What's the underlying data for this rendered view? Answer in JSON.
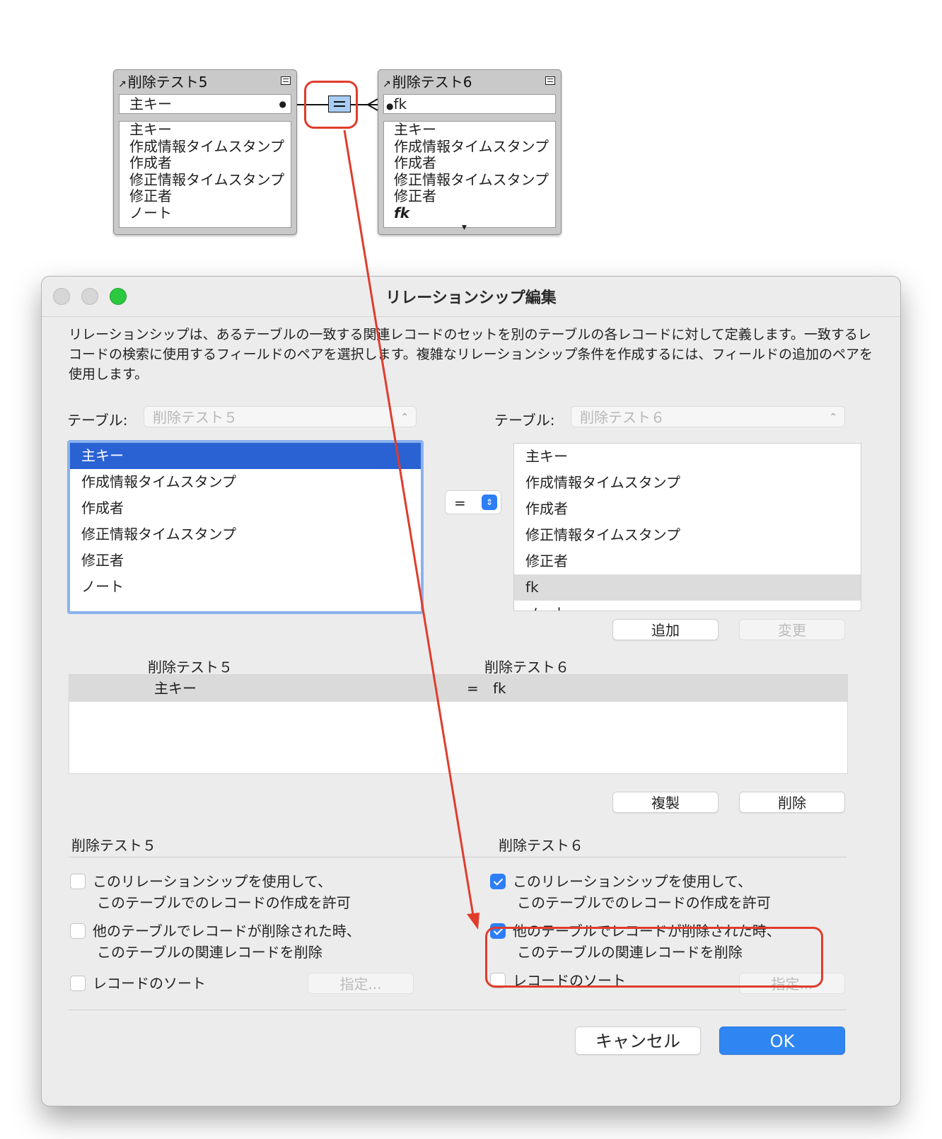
{
  "graph": {
    "left_table": {
      "title": "削除テスト5",
      "key_field": "主キー",
      "fields": [
        "主キー",
        "作成情報タイムスタンプ",
        "作成者",
        "修正情報タイムスタンプ",
        "修正者",
        "ノート"
      ]
    },
    "right_table": {
      "title": "削除テスト6",
      "key_field": "fk",
      "fields": [
        "主キー",
        "作成情報タイムスタンプ",
        "作成者",
        "修正情報タイムスタンプ",
        "修正者",
        "fk"
      ]
    }
  },
  "dialog": {
    "title": "リレーションシップ編集",
    "description": "リレーションシップは、あるテーブルの一致する関連レコードのセットを別のテーブルの各レコードに対して定義します。一致するレコードの検索に使用するフィールドのペアを選択します。複雑なリレーションシップ条件を作成するには、フィールドの追加のペアを使用します。",
    "left": {
      "table_label": "テーブル:",
      "table_value": "削除テスト５",
      "fields": [
        "主キー",
        "作成情報タイムスタンプ",
        "作成者",
        "修正情報タイムスタンプ",
        "修正者",
        "ノート"
      ],
      "selected_field": "主キー"
    },
    "right": {
      "table_label": "テーブル:",
      "table_value": "削除テスト６",
      "fields": [
        "主キー",
        "作成情報タイムスタンプ",
        "作成者",
        "修正情報タイムスタンプ",
        "修正者",
        "fk",
        "ノート"
      ],
      "highlighted_field": "fk"
    },
    "operator": "=",
    "buttons": {
      "add": "追加",
      "change": "変更",
      "duplicate": "複製",
      "delete": "削除",
      "cancel": "キャンセル",
      "ok": "OK",
      "specify_left": "指定...",
      "specify_right": "指定..."
    },
    "pairs_header": {
      "left": "削除テスト５",
      "right": "削除テスト６"
    },
    "pairs": [
      {
        "left": "主キー",
        "op": "=",
        "right": "fk"
      }
    ],
    "options_left": {
      "heading": "削除テスト５",
      "allow_create_line1": "このリレーションシップを使用して、",
      "allow_create_line2": "このテーブルでのレコードの作成を許可",
      "allow_create_checked": false,
      "delete_related_line1": "他のテーブルでレコードが削除された時、",
      "delete_related_line2": "このテーブルの関連レコードを削除",
      "delete_related_checked": false,
      "sort_records": "レコードのソート",
      "sort_checked": false
    },
    "options_right": {
      "heading": "削除テスト６",
      "allow_create_line1": "このリレーションシップを使用して、",
      "allow_create_line2": "このテーブルでのレコードの作成を許可",
      "allow_create_checked": true,
      "delete_related_line1": "他のテーブルでレコードが削除された時、",
      "delete_related_line2": "このテーブルの関連レコードを削除",
      "delete_related_checked": true,
      "sort_records": "レコードのソート",
      "sort_checked": false
    }
  },
  "colors": {
    "accent": "#2d7ef6",
    "selection": "#2a62d4",
    "annotation": "#e03c2c"
  }
}
